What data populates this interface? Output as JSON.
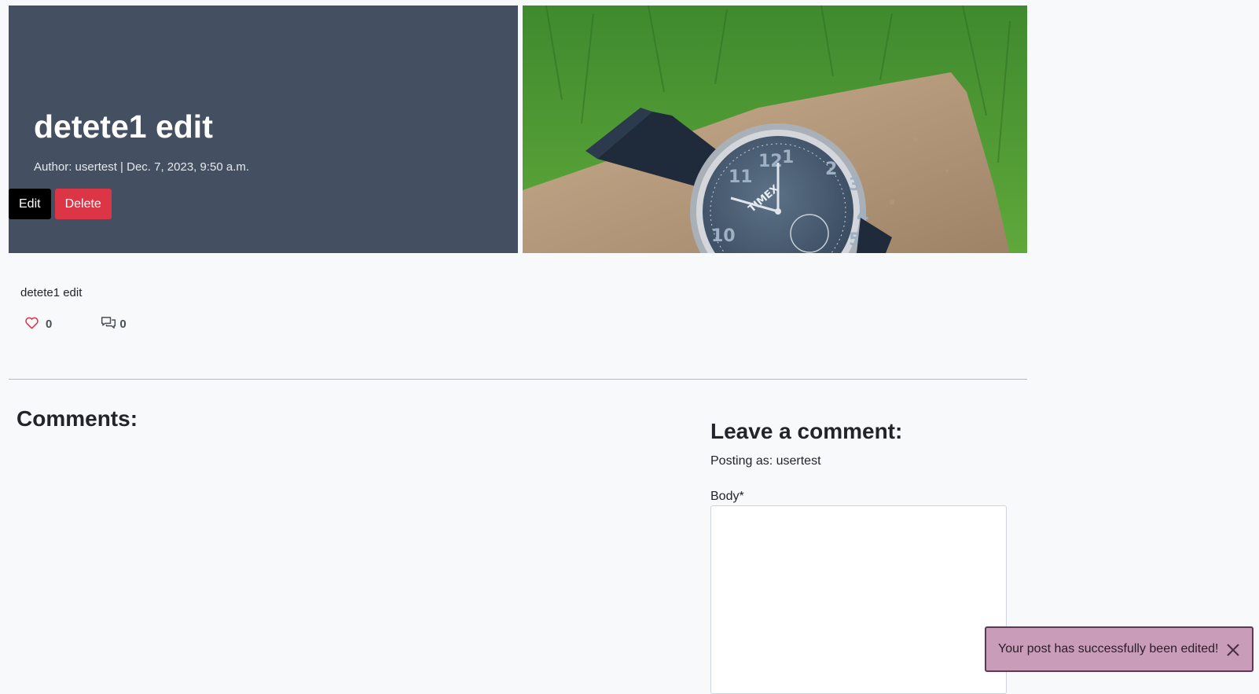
{
  "post": {
    "title": "detete1 edit",
    "meta": "Author: usertest | Dec. 7, 2023, 9:50 a.m.",
    "body": "detete1 edit",
    "likes": "0",
    "comment_count": "0"
  },
  "actions": {
    "edit_label": "Edit",
    "delete_label": "Delete"
  },
  "hero_image": {
    "alt": "Timex wristwatch on a rock in grass",
    "brand_text": "TIMEX"
  },
  "comments_section": {
    "heading": "Comments:"
  },
  "comment_form": {
    "heading": "Leave a comment:",
    "posting_as": "Posting as: usertest",
    "body_label": "Body*",
    "body_value": ""
  },
  "toast": {
    "message": "Your post has successfully been edited!"
  },
  "colors": {
    "hero_bg": "#445061",
    "delete_btn": "#dc3545",
    "edit_btn": "#000000",
    "like_heart": "#dc3545",
    "toast_bg": "#c99cba"
  },
  "icons": {
    "like": "heart-outline-icon",
    "comments": "chat-bubbles-icon",
    "close": "close-icon"
  }
}
